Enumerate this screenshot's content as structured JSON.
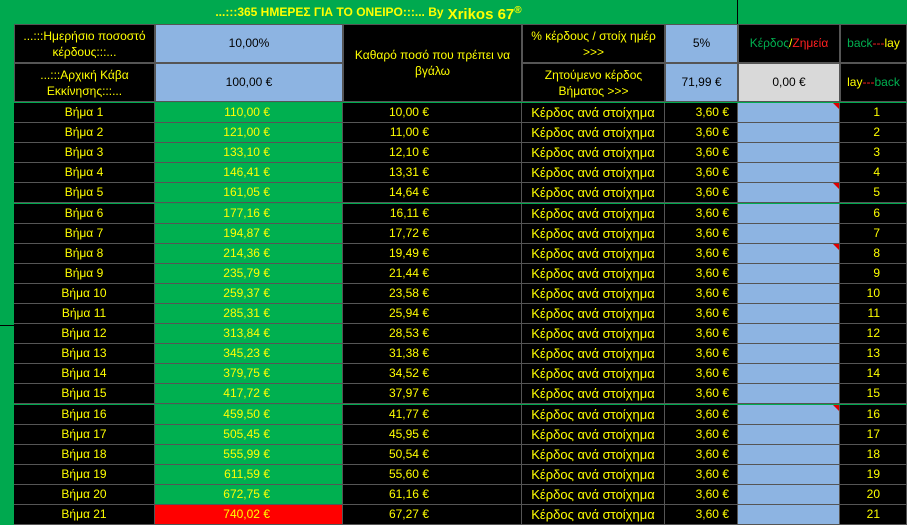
{
  "header": {
    "title_main": "...:::365 ΗΜΕΡΕΣ ΓΙΑ ΤΟ ΟΝΕΙΡΟ:::...  By",
    "title_brand": "Xrikos 67",
    "title_reg": "®"
  },
  "settings": {
    "daily_pct_label": "...:::Ημερήσιο ποσοστό κέρδους:::...",
    "daily_pct_value": "10,00%",
    "start_bank_label": "...:::Αρχική Κάβα Εκκίνησης:::...",
    "start_bank_value": "100,00 €",
    "net_label": "Καθαρό ποσό που πρέπει να βγάλω",
    "profit_pct_label": "% κέρδους / στοίχ ημέρ      >>>",
    "profit_pct_value": "5%",
    "step_target_label": "Ζητούμενο κέρδος Βήματος   >>>",
    "step_target_value": "71,99 €",
    "pnl_value": "0,00 €",
    "profit_word": "Κέρδος",
    "slash": "/",
    "loss_word": "Ζημεία",
    "back_word": "back",
    "dash": "---",
    "lay_word": "lay"
  },
  "rows": [
    {
      "step": "Βήμα 1",
      "bal": "110,00 €",
      "net": "10,00 €",
      "lbl": "Κέρδος ανά στοίχημα",
      "pct": "3,60 €",
      "n": "1",
      "tri": true
    },
    {
      "step": "Βήμα 2",
      "bal": "121,00 €",
      "net": "11,00 €",
      "lbl": "Κέρδος ανά στοίχημα",
      "pct": "3,60 €",
      "n": "2",
      "tri": false
    },
    {
      "step": "Βήμα 3",
      "bal": "133,10 €",
      "net": "12,10 €",
      "lbl": "Κέρδος ανά στοίχημα",
      "pct": "3,60 €",
      "n": "3",
      "tri": false
    },
    {
      "step": "Βήμα 4",
      "bal": "146,41 €",
      "net": "13,31 €",
      "lbl": "Κέρδος ανά στοίχημα",
      "pct": "3,60 €",
      "n": "4",
      "tri": false
    },
    {
      "step": "Βήμα 5",
      "bal": "161,05 €",
      "net": "14,64 €",
      "lbl": "Κέρδος ανά στοίχημα",
      "pct": "3,60 €",
      "n": "5",
      "tri": true
    },
    {
      "step": "Βήμα 6",
      "bal": "177,16 €",
      "net": "16,11 €",
      "lbl": "Κέρδος ανά στοίχημα",
      "pct": "3,60 €",
      "n": "6",
      "tri": false
    },
    {
      "step": "Βήμα 7",
      "bal": "194,87 €",
      "net": "17,72 €",
      "lbl": "Κέρδος ανά στοίχημα",
      "pct": "3,60 €",
      "n": "7",
      "tri": false
    },
    {
      "step": "Βήμα 8",
      "bal": "214,36 €",
      "net": "19,49 €",
      "lbl": "Κέρδος ανά στοίχημα",
      "pct": "3,60 €",
      "n": "8",
      "tri": true
    },
    {
      "step": "Βήμα 9",
      "bal": "235,79 €",
      "net": "21,44 €",
      "lbl": "Κέρδος ανά στοίχημα",
      "pct": "3,60 €",
      "n": "9",
      "tri": false
    },
    {
      "step": "Βήμα 10",
      "bal": "259,37 €",
      "net": "23,58 €",
      "lbl": "Κέρδος ανά στοίχημα",
      "pct": "3,60 €",
      "n": "10",
      "tri": false
    },
    {
      "step": "Βήμα 11",
      "bal": "285,31 €",
      "net": "25,94 €",
      "lbl": "Κέρδος ανά στοίχημα",
      "pct": "3,60 €",
      "n": "11",
      "tri": false
    },
    {
      "step": "Βήμα 12",
      "bal": "313,84 €",
      "net": "28,53 €",
      "lbl": "Κέρδος ανά στοίχημα",
      "pct": "3,60 €",
      "n": "12",
      "tri": false
    },
    {
      "step": "Βήμα 13",
      "bal": "345,23 €",
      "net": "31,38 €",
      "lbl": "Κέρδος ανά στοίχημα",
      "pct": "3,60 €",
      "n": "13",
      "tri": false
    },
    {
      "step": "Βήμα 14",
      "bal": "379,75 €",
      "net": "34,52 €",
      "lbl": "Κέρδος ανά στοίχημα",
      "pct": "3,60 €",
      "n": "14",
      "tri": false
    },
    {
      "step": "Βήμα 15",
      "bal": "417,72 €",
      "net": "37,97 €",
      "lbl": "Κέρδος ανά στοίχημα",
      "pct": "3,60 €",
      "n": "15",
      "tri": false
    },
    {
      "step": "Βήμα 16",
      "bal": "459,50 €",
      "net": "41,77 €",
      "lbl": "Κέρδος ανά στοίχημα",
      "pct": "3,60 €",
      "n": "16",
      "tri": true
    },
    {
      "step": "Βήμα 17",
      "bal": "505,45 €",
      "net": "45,95 €",
      "lbl": "Κέρδος ανά στοίχημα",
      "pct": "3,60 €",
      "n": "17",
      "tri": false
    },
    {
      "step": "Βήμα 18",
      "bal": "555,99 €",
      "net": "50,54 €",
      "lbl": "Κέρδος ανά στοίχημα",
      "pct": "3,60 €",
      "n": "18",
      "tri": false
    },
    {
      "step": "Βήμα 19",
      "bal": "611,59 €",
      "net": "55,60 €",
      "lbl": "Κέρδος ανά στοίχημα",
      "pct": "3,60 €",
      "n": "19",
      "tri": false
    },
    {
      "step": "Βήμα 20",
      "bal": "672,75 €",
      "net": "61,16 €",
      "lbl": "Κέρδος ανά στοίχημα",
      "pct": "3,60 €",
      "n": "20",
      "tri": false
    },
    {
      "step": "Βήμα 21",
      "bal": "740,02 €",
      "net": "67,27 €",
      "lbl": "Κέρδος ανά στοίχημα",
      "pct": "3,60 €",
      "n": "21",
      "tri": false,
      "highlight": true
    }
  ],
  "colors": {
    "green": "#00b050",
    "red_cell": "#ff0000",
    "input_blue": "#8db4e2",
    "text_yellow": "#ffff00"
  }
}
